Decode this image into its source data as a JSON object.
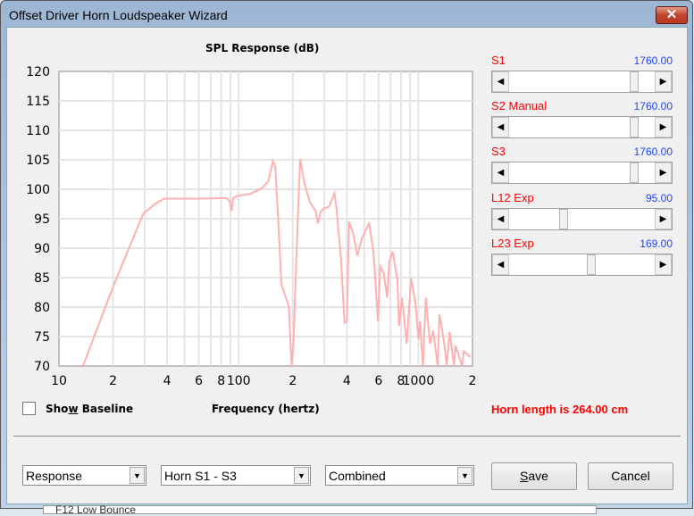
{
  "window": {
    "title": "Offset Driver Horn Loudspeaker Wizard",
    "close_label": "✕"
  },
  "background_text": "F12 Low Bounce",
  "sliders": [
    {
      "label": "S1",
      "value": "1760.00",
      "position": 0.87
    },
    {
      "label": "S2  Manual",
      "value": "1760.00",
      "position": 0.87
    },
    {
      "label": "S3",
      "value": "1760.00",
      "position": 0.87
    },
    {
      "label": "L12  Exp",
      "value": "95.00",
      "position": 0.36
    },
    {
      "label": "L23  Exp",
      "value": "169.00",
      "position": 0.56
    }
  ],
  "show_baseline": {
    "label_pre": "Sho",
    "label_u": "w",
    "label_post": " Baseline",
    "checked": false
  },
  "horn_length": "Horn length is 264.00 cm",
  "combos": {
    "view": "Response",
    "section": "Horn S1 - S3",
    "mode": "Combined"
  },
  "buttons": {
    "save_u": "S",
    "save_rest": "ave",
    "cancel": "Cancel"
  },
  "colors": {
    "curve": "#ffb0b0",
    "grid": "#e4e4e4",
    "label": "#ff0000",
    "value": "#2244ee"
  },
  "chart_data": {
    "type": "line",
    "title": "SPL Response (dB)",
    "xlabel": "Frequency (hertz)",
    "ylabel": "",
    "xscale": "log",
    "xlim": [
      10,
      2000
    ],
    "ylim": [
      70,
      120
    ],
    "grid": true,
    "yticks": [
      120,
      115,
      110,
      105,
      100,
      95,
      90,
      85,
      80,
      75,
      70
    ],
    "xticks": [
      {
        "v": 10,
        "t": "10"
      },
      {
        "v": 20,
        "t": "2"
      },
      {
        "v": 40,
        "t": "4"
      },
      {
        "v": 60,
        "t": "6"
      },
      {
        "v": 80,
        "t": "8"
      },
      {
        "v": 100,
        "t": "100"
      },
      {
        "v": 200,
        "t": "2"
      },
      {
        "v": 400,
        "t": "4"
      },
      {
        "v": 600,
        "t": "6"
      },
      {
        "v": 800,
        "t": "8"
      },
      {
        "v": 1000,
        "t": "1000"
      },
      {
        "v": 2000,
        "t": "2"
      }
    ],
    "series": [
      {
        "name": "SPL",
        "x": [
          13.6,
          20.1,
          29.4,
          34.2,
          38.4,
          58.4,
          85.6,
          89,
          91.6,
          92.9,
          99.6,
          116,
          135,
          146,
          155,
          160,
          166,
          173,
          190,
          197,
          202,
          206,
          213,
          220,
          231,
          249,
          268,
          276,
          287,
          300,
          318,
          341,
          350,
          371,
          388,
          400,
          411,
          432,
          457,
          485,
          532,
          563,
          596,
          613,
          642,
          670,
          688,
          720,
          764,
          780,
          811,
          860,
          910,
          964,
          1000,
          1020,
          1060,
          1100,
          1160,
          1210,
          1280,
          1310,
          1390,
          1440,
          1490,
          1580,
          1610,
          1750,
          1790,
          1950
        ],
        "y": [
          70,
          83.6,
          95.8,
          97.5,
          98.4,
          98.4,
          98.5,
          98,
          96.3,
          98.5,
          98.9,
          99.2,
          100.2,
          101.3,
          104.8,
          103.8,
          94.7,
          83.9,
          80.1,
          70,
          74,
          82,
          94.7,
          105.2,
          101.3,
          97.8,
          96.3,
          94.2,
          96.3,
          96.8,
          97,
          99.3,
          96.8,
          88.2,
          77.3,
          77.6,
          94.5,
          92.7,
          88.7,
          91.7,
          94.2,
          89.2,
          77.6,
          86.9,
          85.7,
          81.6,
          87.7,
          89.4,
          84.6,
          76.8,
          81.6,
          73.8,
          84.9,
          80.6,
          74.5,
          77.6,
          70,
          81.6,
          73.8,
          76,
          70,
          78.8,
          74,
          70,
          75.8,
          70,
          73.5,
          70,
          72.5,
          71.5
        ]
      }
    ]
  }
}
